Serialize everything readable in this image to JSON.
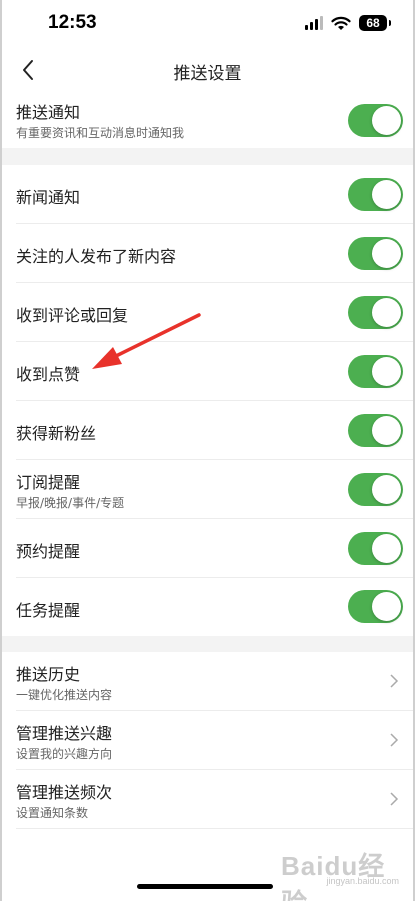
{
  "status": {
    "time": "12:53",
    "battery": "68"
  },
  "nav": {
    "title": "推送设置"
  },
  "push_notification": {
    "title": "推送通知",
    "subtitle": "有重要资讯和互动消息时通知我",
    "on": true
  },
  "notification_items": [
    {
      "title": "新闻通知",
      "subtitle": "",
      "on": true
    },
    {
      "title": "关注的人发布了新内容",
      "subtitle": "",
      "on": true
    },
    {
      "title": "收到评论或回复",
      "subtitle": "",
      "on": true
    },
    {
      "title": "收到点赞",
      "subtitle": "",
      "on": true
    },
    {
      "title": "获得新粉丝",
      "subtitle": "",
      "on": true
    },
    {
      "title": "订阅提醒",
      "subtitle": "早报/晚报/事件/专题",
      "on": true
    },
    {
      "title": "预约提醒",
      "subtitle": "",
      "on": true
    },
    {
      "title": "任务提醒",
      "subtitle": "",
      "on": true
    }
  ],
  "link_items": [
    {
      "title": "推送历史",
      "subtitle": "一键优化推送内容"
    },
    {
      "title": "管理推送兴趣",
      "subtitle": "设置我的兴趣方向"
    },
    {
      "title": "管理推送频次",
      "subtitle": "设置通知条数"
    }
  ],
  "watermark": {
    "logo": "Baidu经验",
    "url": "jingyan.baidu.com"
  },
  "colors": {
    "toggle_on": "#4caf50",
    "section_gap": "#f3f3f3",
    "arrow": "#e8322b"
  },
  "icons": [
    "back-chevron-icon",
    "chevron-right-icon",
    "signal-icon",
    "wifi-icon",
    "battery-icon"
  ]
}
